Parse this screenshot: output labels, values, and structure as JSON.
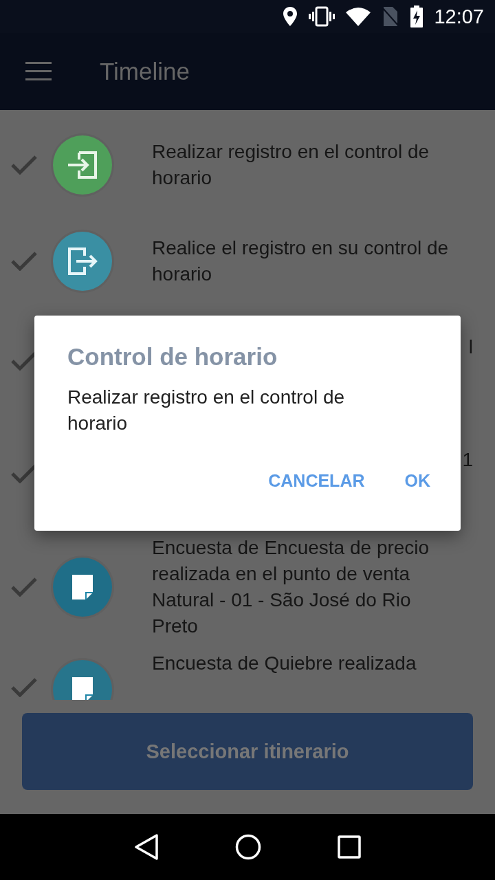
{
  "status_bar": {
    "time": "12:07"
  },
  "app_bar": {
    "title": "Timeline"
  },
  "timeline": [
    {
      "kind": "check_in",
      "color": "#4f9f5a",
      "text": "Realizar registro en el control de horario"
    },
    {
      "kind": "check_out",
      "color": "#3a8fa3",
      "text": "Realice el registro en su control de horario"
    },
    {
      "kind": "covered",
      "text": "l"
    },
    {
      "kind": "covered",
      "text": "1"
    },
    {
      "kind": "document",
      "color": "#1f6e88",
      "text": "Encuesta de Encuesta de precio realizada en el punto de venta Natural - 01 - São José do Rio Preto"
    },
    {
      "kind": "document",
      "color": "#27758c",
      "text": "Encuesta de Quiebre realizada"
    }
  ],
  "bottom_button": {
    "label": "Seleccionar itinerario"
  },
  "dialog": {
    "title": "Control de horario",
    "message": "Realizar registro en el control de horario",
    "buttons": [
      "CANCELAR",
      "OK"
    ]
  }
}
